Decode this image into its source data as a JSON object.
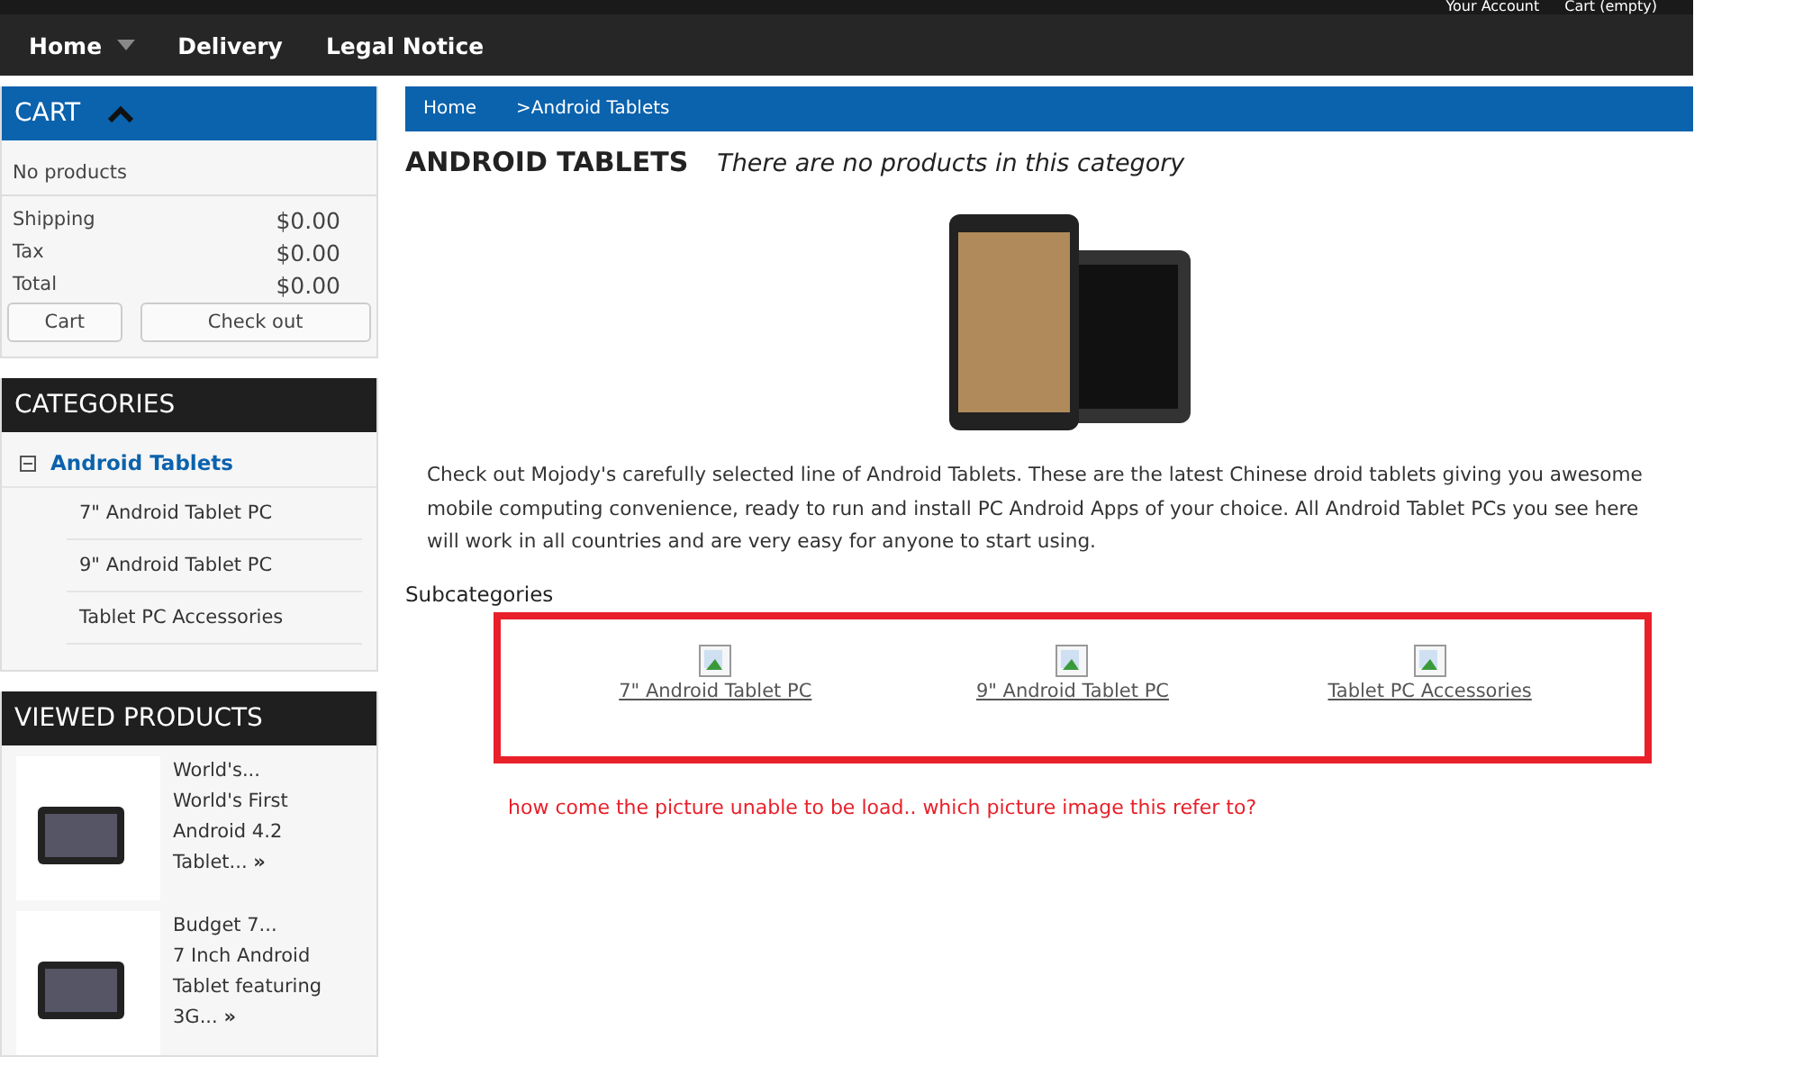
{
  "top_links": [
    "Your Account",
    "Cart (empty)"
  ],
  "nav": [
    {
      "label": "Home",
      "has_dropdown": true
    },
    {
      "label": "Delivery",
      "has_dropdown": false
    },
    {
      "label": "Legal Notice",
      "has_dropdown": false
    }
  ],
  "cart": {
    "title": "CART",
    "expanded": true,
    "empty_text": "No products",
    "lines": [
      {
        "label": "Shipping",
        "value": "$0.00"
      },
      {
        "label": "Tax",
        "value": "$0.00"
      },
      {
        "label": "Total",
        "value": "$0.00"
      }
    ],
    "buttons": [
      "Cart",
      "Check out"
    ]
  },
  "categories": {
    "title": "CATEGORIES",
    "items": [
      {
        "label": "Android Tablets",
        "expanded": true,
        "selected": true,
        "children": [
          {
            "label": "7\" Android Tablet PC",
            "selected": false
          },
          {
            "label": "9\" Android Tablet PC",
            "selected": false
          },
          {
            "label": "Tablet PC Accessories",
            "selected": false
          }
        ]
      }
    ]
  },
  "viewed": {
    "title": "VIEWED PRODUCTS",
    "products": [
      {
        "name": "World's...",
        "description": "World's First Android 4.2 Tablet...",
        "more": "»"
      },
      {
        "name": "Budget 7...",
        "description": "7 Inch Android Tablet featuring 3G...",
        "more": "»"
      }
    ]
  },
  "breadcrumb": [
    "Home",
    ">Android Tablets"
  ],
  "heading": "ANDROID TABLETS",
  "heading_note": "There are no products in this category",
  "description": "Check out Mojody's carefully selected line of Android Tablets. These are the latest Chinese droid tablets giving you awesome mobile computing convenience, ready to run and install PC Android Apps of your choice. All Android Tablet PCs you see here will work in all countries and are very easy for anyone to start using.",
  "subcategories": {
    "title": "Subcategories",
    "items": [
      "7\" Android Tablet PC",
      "9\" Android Tablet PC",
      "Tablet PC Accessories"
    ]
  },
  "annotation": "how come the picture unable to be load.. which picture image this refer to?"
}
